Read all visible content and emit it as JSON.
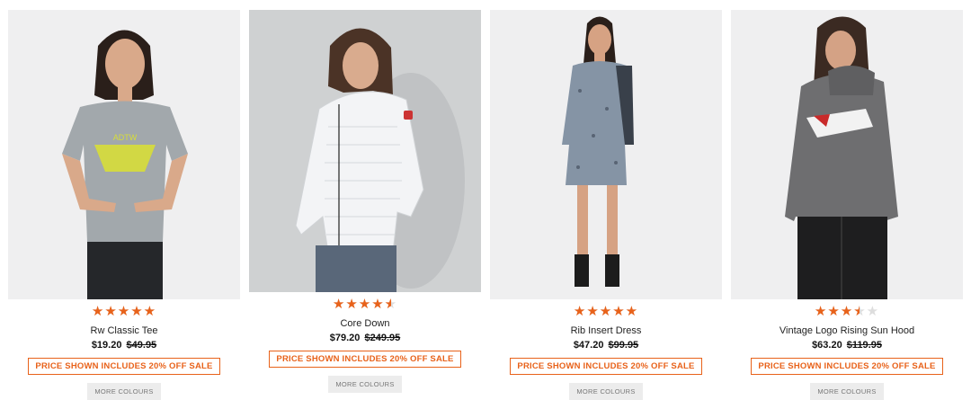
{
  "products": [
    {
      "name": "Rw Classic Tee",
      "price": "$19.20",
      "was_price": "$49.95",
      "rating": 5,
      "promo": "PRICE SHOWN INCLUDES 20% OFF SALE",
      "more_colours": "MORE COLOURS",
      "image_desc": "woman-in-grey-tee"
    },
    {
      "name": "Core Down",
      "price": "$79.20",
      "was_price": "$249.95",
      "rating": 4.5,
      "promo": "PRICE SHOWN INCLUDES 20% OFF SALE",
      "more_colours": "MORE COLOURS",
      "image_desc": "woman-in-white-down-jacket"
    },
    {
      "name": "Rib Insert Dress",
      "price": "$47.20",
      "was_price": "$99.95",
      "rating": 5,
      "promo": "PRICE SHOWN INCLUDES 20% OFF SALE",
      "more_colours": "MORE COLOURS",
      "image_desc": "woman-in-printed-dress"
    },
    {
      "name": "Vintage Logo Rising Sun Hood",
      "price": "$63.20",
      "was_price": "$119.95",
      "rating": 3.5,
      "promo": "PRICE SHOWN INCLUDES 20% OFF SALE",
      "more_colours": "MORE COLOURS",
      "image_desc": "woman-in-grey-hoodie"
    }
  ],
  "colors": {
    "accent": "#e8621a",
    "image_bg": "#efeff0",
    "button_bg": "#ececec"
  }
}
